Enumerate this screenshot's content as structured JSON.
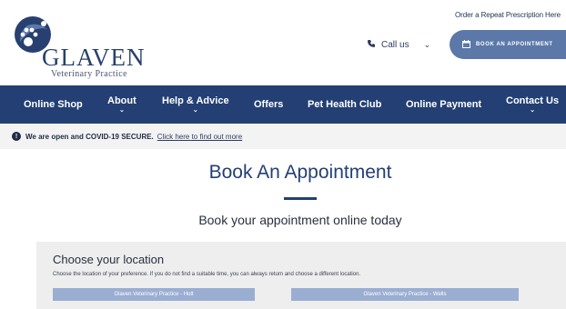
{
  "header": {
    "logo": {
      "name": "GLAVEN",
      "tagline": "Veterinary Practice"
    },
    "repeat_prescription": "Order a Repeat Prescription Here",
    "call_us": "Call us",
    "book_button": "BOOK AN APPOINTMENT"
  },
  "nav": {
    "items": [
      {
        "label": "Online Shop",
        "has_dropdown": false
      },
      {
        "label": "About",
        "has_dropdown": true
      },
      {
        "label": "Help & Advice",
        "has_dropdown": true
      },
      {
        "label": "Offers",
        "has_dropdown": false
      },
      {
        "label": "Pet Health Club",
        "has_dropdown": false
      },
      {
        "label": "Online Payment",
        "has_dropdown": false
      },
      {
        "label": "Contact Us",
        "has_dropdown": true
      }
    ]
  },
  "alert": {
    "bold": "We are open and COVID-19 SECURE.",
    "link": "Click here to find out more"
  },
  "main": {
    "title": "Book An Appointment",
    "subtitle": "Book your appointment online today"
  },
  "location": {
    "title": "Choose your location",
    "description": "Choose the location of your preference. If you do not find a suitable time, you can always return and choose a different location.",
    "options": [
      {
        "label": "Glaven Veterinary Practice - Holt"
      },
      {
        "label": "Glaven Veterinary Practice - Wells"
      }
    ]
  },
  "colors": {
    "navy": "#233f73",
    "button_blue": "#5b78a8",
    "location_button": "#9aaed2",
    "alert_bg": "#f3f3f3"
  }
}
